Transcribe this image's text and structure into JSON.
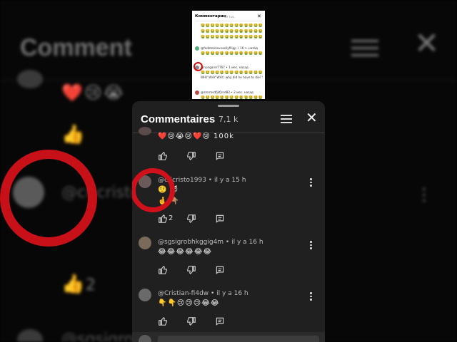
{
  "background": {
    "title": "Comment",
    "emojis": "❤️😢😭",
    "handle": "@cricristo",
    "handle2": "@sgsigrobh",
    "like_count": "2"
  },
  "thumbnail": {
    "title": "Комментарии",
    "count": "39 тыс.",
    "rows": [
      {
        "emoji": "🤮🤮🤮🤮🤮🤮🤮🤮🤮🤮🤮🤮🤮🤮"
      },
      {
        "emoji": "🤮🤮🤮🤮🤮🤮🤮🤮🤮🤮🤮🤮🤮🤮"
      },
      {
        "text": "@fedotenkovvasilyfilipp • 16 ч. назад"
      },
      {
        "text": "@hungarer7767 • 1 мес. назад"
      },
      {
        "text": "@smrmsdfjkfjrnd82 • 2 мес. назад"
      }
    ],
    "extra_text": "WHY WHY WHY, why did he have to die? WHY!"
  },
  "panel": {
    "title": "Commentaires",
    "count": "7,1 k",
    "comments": [
      {
        "author": "",
        "body": "❤️😢😭😢❤️😢  100k",
        "likes": ""
      },
      {
        "author": "@cricristo1993 • il y a 15 h",
        "body": "🤨        😈",
        "body2": "🤞     👇🏽",
        "likes": "2"
      },
      {
        "author": "@sgsigrobhkggig4m • il y a 16 h",
        "body": "😂😂😂😂😂😂",
        "likes": ""
      },
      {
        "author": "@Cristian-fi4dw • il y a 16 h",
        "body": "👇👇😢😢😢😂😂",
        "likes": ""
      }
    ]
  },
  "colors": {
    "accent_ring": "#d0101a",
    "panel_bg": "#202020"
  }
}
